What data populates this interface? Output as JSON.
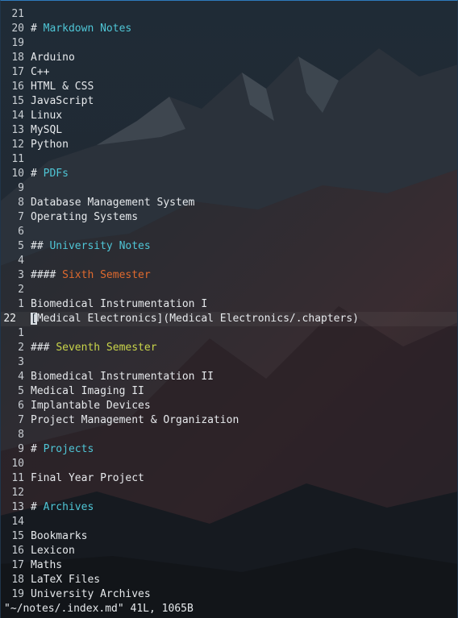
{
  "colors": {
    "heading_cyan": "#4fc6d6",
    "heading_orange": "#df6a2e",
    "heading_yellow": "#c9d54a",
    "text": "#e6e9ec",
    "window_border_accent": "#2e7bbd"
  },
  "editor": {
    "lines": [
      {
        "num": "21",
        "text": ""
      },
      {
        "num": "20",
        "prefix": "# ",
        "heading": "Markdown Notes",
        "style": "cyan"
      },
      {
        "num": "19",
        "text": ""
      },
      {
        "num": "18",
        "text": "Arduino"
      },
      {
        "num": "17",
        "text": "C++"
      },
      {
        "num": "16",
        "text": "HTML & CSS"
      },
      {
        "num": "15",
        "text": "JavaScript"
      },
      {
        "num": "14",
        "text": "Linux"
      },
      {
        "num": "13",
        "text": "MySQL"
      },
      {
        "num": "12",
        "text": "Python"
      },
      {
        "num": "11",
        "text": ""
      },
      {
        "num": "10",
        "prefix": "# ",
        "heading": "PDFs",
        "style": "cyan"
      },
      {
        "num": "9",
        "text": ""
      },
      {
        "num": "8",
        "text": "Database Management System"
      },
      {
        "num": "7",
        "text": "Operating Systems"
      },
      {
        "num": "6",
        "text": ""
      },
      {
        "num": "5",
        "prefix": "## ",
        "heading": "University Notes",
        "style": "cyan"
      },
      {
        "num": "4",
        "text": ""
      },
      {
        "num": "3",
        "prefix": "#### ",
        "heading": "Sixth Semester",
        "style": "orange"
      },
      {
        "num": "2",
        "text": ""
      },
      {
        "num": "1",
        "text": "Biomedical Instrumentation I"
      },
      {
        "num": "22",
        "cursor": "[",
        "text": "Medical Electronics](Medical Electronics/.chapters)",
        "current": true
      },
      {
        "num": "1",
        "text": ""
      },
      {
        "num": "2",
        "prefix": "### ",
        "heading": "Seventh Semester",
        "style": "yellow"
      },
      {
        "num": "3",
        "text": ""
      },
      {
        "num": "4",
        "text": "Biomedical Instrumentation II"
      },
      {
        "num": "5",
        "text": "Medical Imaging II"
      },
      {
        "num": "6",
        "text": "Implantable Devices"
      },
      {
        "num": "7",
        "text": "Project Management & Organization"
      },
      {
        "num": "8",
        "text": ""
      },
      {
        "num": "9",
        "prefix": "# ",
        "heading": "Projects",
        "style": "cyan"
      },
      {
        "num": "10",
        "text": ""
      },
      {
        "num": "11",
        "text": "Final Year Project"
      },
      {
        "num": "12",
        "text": ""
      },
      {
        "num": "13",
        "prefix": "# ",
        "heading": "Archives",
        "style": "cyan"
      },
      {
        "num": "14",
        "text": ""
      },
      {
        "num": "15",
        "text": "Bookmarks"
      },
      {
        "num": "16",
        "text": "Lexicon"
      },
      {
        "num": "17",
        "text": "Maths"
      },
      {
        "num": "18",
        "text": "LaTeX Files"
      },
      {
        "num": "19",
        "text": "University Archives"
      }
    ]
  },
  "status": {
    "message": "\"~/notes/.index.md\" 41L, 1065B"
  }
}
